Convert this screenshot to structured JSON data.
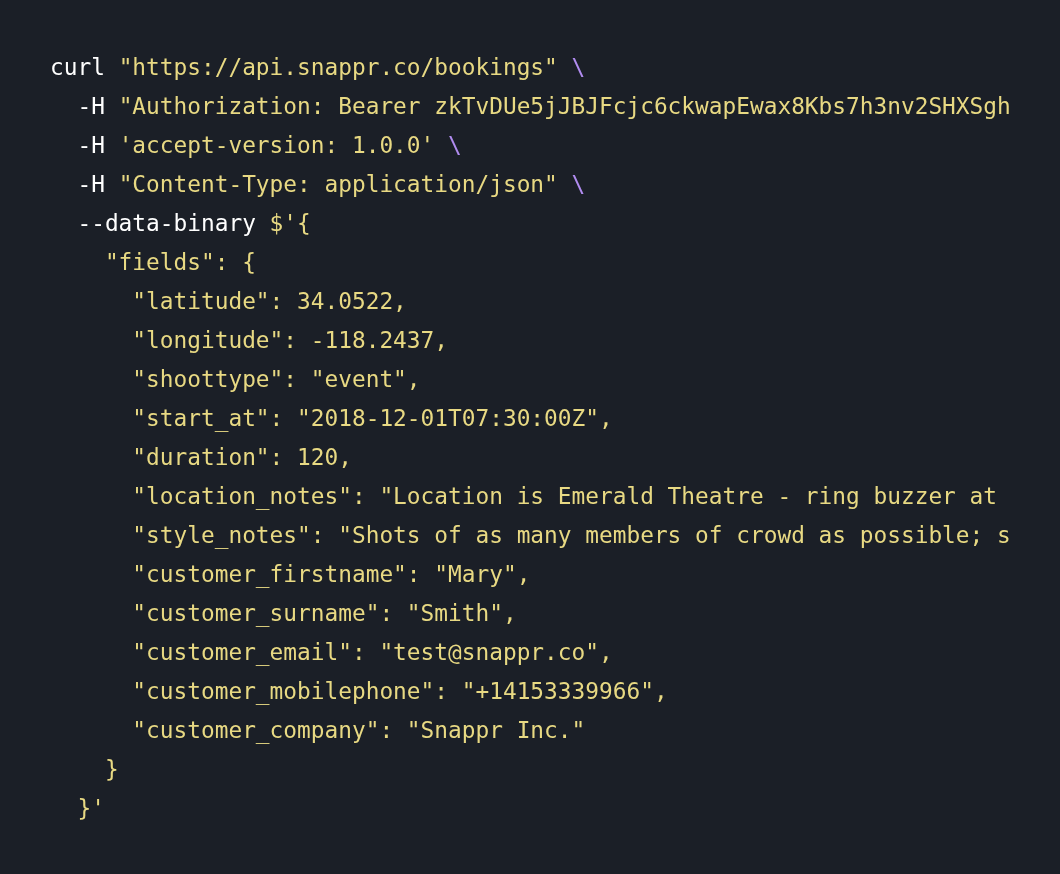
{
  "code_block": {
    "lines": [
      [
        {
          "kind": "plain",
          "text": "curl "
        },
        {
          "kind": "string",
          "text": "\"https://api.snappr.co/bookings\""
        },
        {
          "kind": "escape",
          "text": " \\"
        }
      ],
      [
        {
          "kind": "plain",
          "text": "  -H "
        },
        {
          "kind": "string",
          "text": "\"Authorization: Bearer zkTvDUe5jJBJFcjc6ckwapEwax8Kbs7h3nv2SHXSgh"
        }
      ],
      [
        {
          "kind": "plain",
          "text": "  -H "
        },
        {
          "kind": "string",
          "text": "'accept-version: 1.0.0'"
        },
        {
          "kind": "escape",
          "text": " \\"
        }
      ],
      [
        {
          "kind": "plain",
          "text": "  -H "
        },
        {
          "kind": "string",
          "text": "\"Content-Type: application/json\""
        },
        {
          "kind": "escape",
          "text": " \\"
        }
      ],
      [
        {
          "kind": "plain",
          "text": "  --data-binary "
        },
        {
          "kind": "string",
          "text": "$'{"
        }
      ],
      [
        {
          "kind": "string",
          "text": "    \"fields\": {"
        }
      ],
      [
        {
          "kind": "string",
          "text": "      \"latitude\": 34.0522,"
        }
      ],
      [
        {
          "kind": "string",
          "text": "      \"longitude\": -118.2437,"
        }
      ],
      [
        {
          "kind": "string",
          "text": "      \"shoottype\": \"event\","
        }
      ],
      [
        {
          "kind": "string",
          "text": "      \"start_at\": \"2018-12-01T07:30:00Z\","
        }
      ],
      [
        {
          "kind": "string",
          "text": "      \"duration\": 120,"
        }
      ],
      [
        {
          "kind": "string",
          "text": "      \"location_notes\": \"Location is Emerald Theatre - ring buzzer at"
        }
      ],
      [
        {
          "kind": "string",
          "text": "      \"style_notes\": \"Shots of as many members of crowd as possible; s"
        }
      ],
      [
        {
          "kind": "string",
          "text": "      \"customer_firstname\": \"Mary\","
        }
      ],
      [
        {
          "kind": "string",
          "text": "      \"customer_surname\": \"Smith\","
        }
      ],
      [
        {
          "kind": "string",
          "text": "      \"customer_email\": \"test@snappr.co\","
        }
      ],
      [
        {
          "kind": "string",
          "text": "      \"customer_mobilephone\": \"+14153339966\","
        }
      ],
      [
        {
          "kind": "string",
          "text": "      \"customer_company\": \"Snappr Inc.\""
        }
      ],
      [
        {
          "kind": "string",
          "text": "    }"
        }
      ],
      [
        {
          "kind": "string",
          "text": "  }'"
        }
      ]
    ]
  }
}
